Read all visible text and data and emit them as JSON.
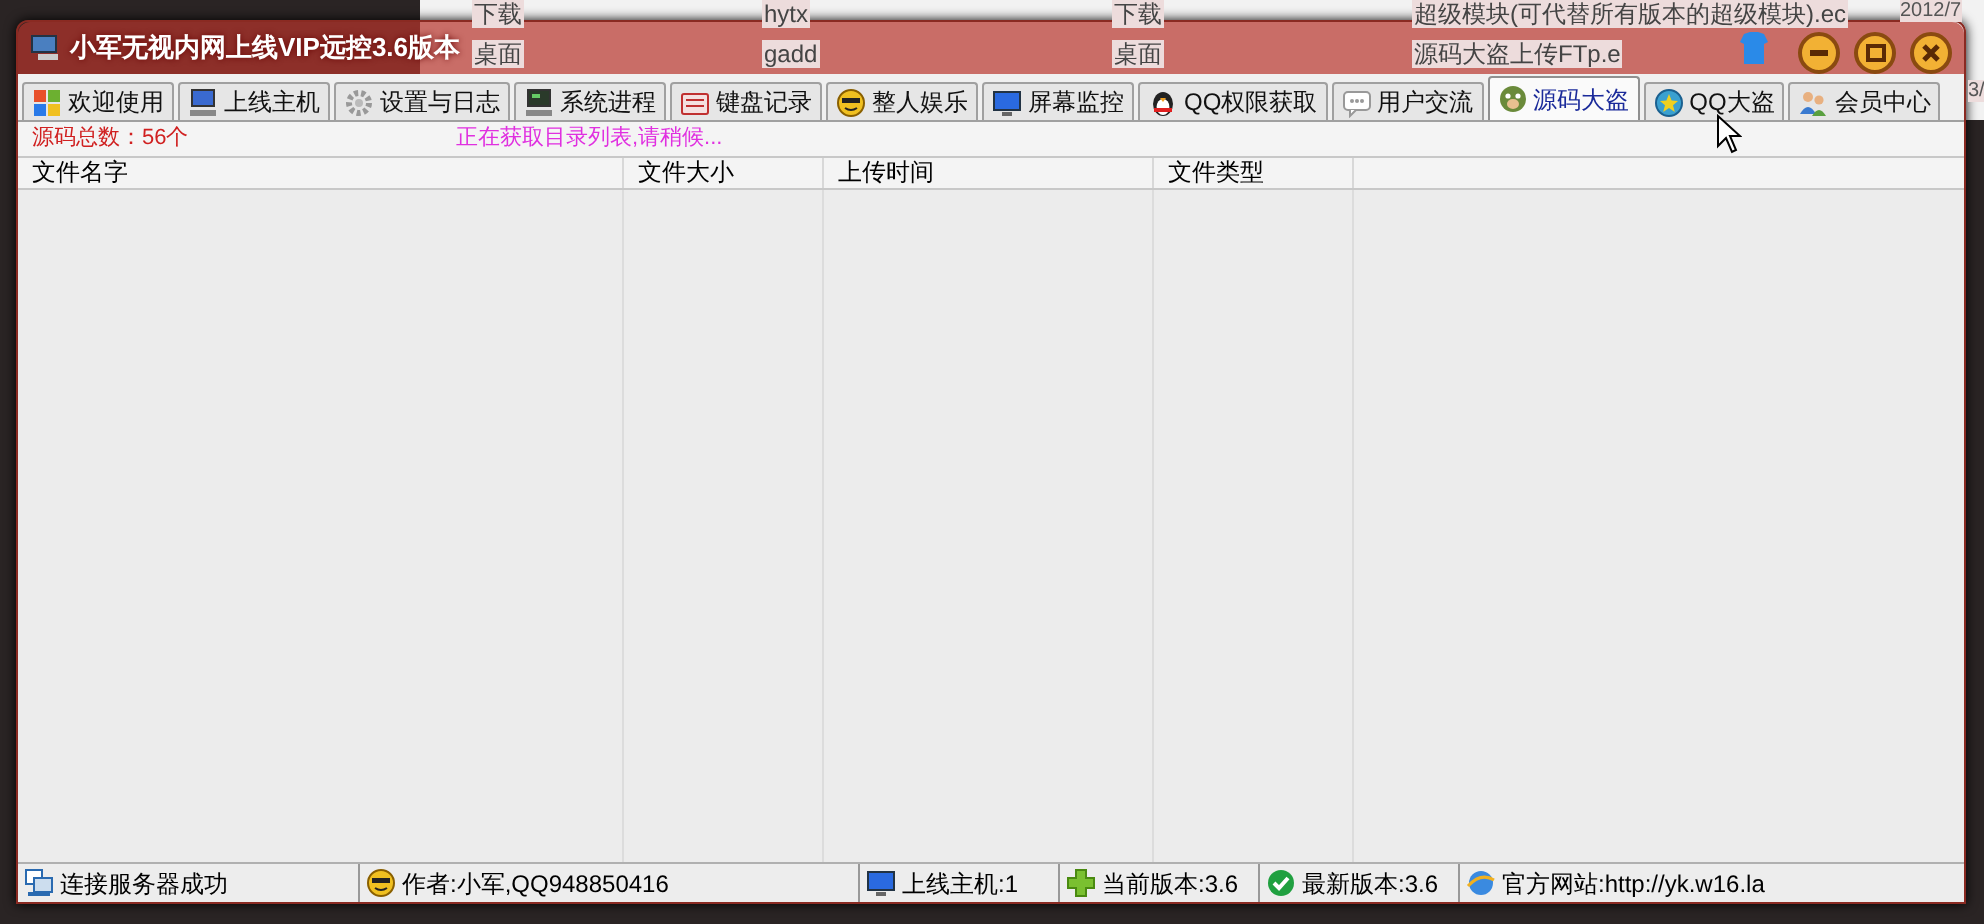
{
  "background_explorer": {
    "columns": [
      [
        "下载",
        "桌面"
      ],
      [
        "hytx",
        "gadd"
      ],
      [
        "下载",
        "桌面"
      ],
      [
        "超级模块(可代替所有版本的超级模块).ec",
        "源码大盗上传FTp.e"
      ]
    ],
    "dates": [
      "2012/7",
      "3/"
    ]
  },
  "window": {
    "title": "小军无视内网上线VIP远控3.6版本"
  },
  "tabs": [
    {
      "label": "欢迎使用",
      "selected": false
    },
    {
      "label": "上线主机",
      "selected": false
    },
    {
      "label": "设置与日志",
      "selected": false
    },
    {
      "label": "系统进程",
      "selected": false
    },
    {
      "label": "键盘记录",
      "selected": false
    },
    {
      "label": "整人娱乐",
      "selected": false
    },
    {
      "label": "屏幕监控",
      "selected": false
    },
    {
      "label": "QQ权限获取",
      "selected": false
    },
    {
      "label": "用户交流",
      "selected": false
    },
    {
      "label": "源码大盗",
      "selected": true
    },
    {
      "label": "QQ大盗",
      "selected": false
    },
    {
      "label": "会员中心",
      "selected": false
    }
  ],
  "info": {
    "count": "源码总数：56个",
    "message": "正在获取目录列表,请稍候..."
  },
  "table": {
    "columns": [
      "文件名字",
      "文件大小",
      "上传时间",
      "文件类型"
    ]
  },
  "status_bar": [
    "连接服务器成功",
    "作者:小军,QQ948850416",
    "上线主机:1",
    "当前版本:3.6",
    "最新版本:3.6",
    "官方网站:http://yk.w16.la"
  ]
}
